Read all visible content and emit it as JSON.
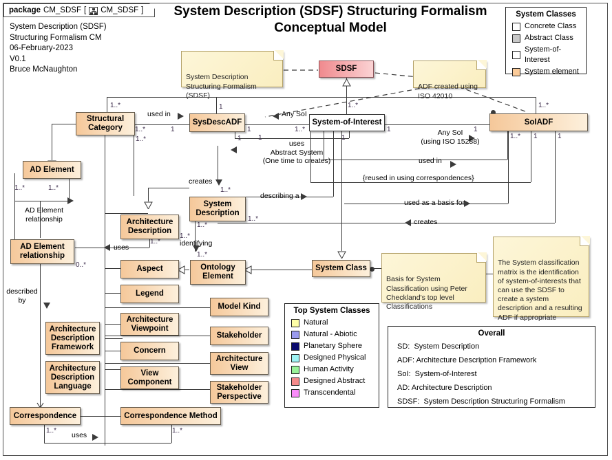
{
  "package": {
    "keyword": "package",
    "name": "CM_SDSF",
    "bracket_open": "[",
    "icon": "diagram-icon",
    "diagram_name": "CM_SDSF",
    "bracket_close": "]"
  },
  "meta": "System Description (SDSF)\nStructuring Formalism CM\n06-February-2023\nV0.1\nBruce McNaughton",
  "title": "System Description (SDSF)\nStructuring Formalism Conceptual Model",
  "classes": {
    "structural_category": "Structural\nCategory",
    "sysdescadf": "SysDescADF",
    "system_of_interest": "System-of-Interest",
    "soiadf": "SoIADF",
    "sdsf": "SDSF",
    "ad_element": "AD Element",
    "ad_element_relationship": "AD Element\nrelationship",
    "system_description": "System\nDescription",
    "architecture_description": "Architecture\nDescription",
    "aspect": "Aspect",
    "ontology_element": "Ontology\nElement",
    "legend": "Legend",
    "system_class": "System Class",
    "model_kind": "Model Kind",
    "stakeholder": "Stakeholder",
    "architecture_view": "Architecture\nView",
    "stakeholder_perspective": "Stakeholder\nPerspective",
    "architecture_viewpoint": "Architecture\nViewpoint",
    "concern": "Concern",
    "view_component": "View\nComponent",
    "adf": "Architecture\nDescription\nFramework",
    "adl": "Architecture\nDescription\nLanguage",
    "correspondence": "Correspondence",
    "correspondence_method": "Correspondence Method"
  },
  "notes": {
    "sdsf_note": "System Description\nStructuring Formalism\n(SDSF)",
    "adf_iso_note": "ADF created using\nISO 42010",
    "basis_note": "Basis for System\nClassification using Peter\nCheckland's top level\nClassifications",
    "matrix_note": "The System classification\nmatrix is the identification\nof system-of-interests that\ncan use the SDSF to\ncreate a system\ndescription and a resulting\nADF if appropriate"
  },
  "edge_labels": {
    "used_in_1": "used in",
    "any_soi_1": "Any SoI",
    "any_soi_iso": "Any SoI\n(using ISO 15288)",
    "uses_abstract": "uses\nAbstract System\n(One time to creates)",
    "used_in_2": "used in",
    "reused_note": "{reused in using correspondences}",
    "creates_top": "creates",
    "describing_a": "describing a",
    "used_as_basis_for": "used as a basis for",
    "creates_right": "creates",
    "uses_ad": "uses",
    "identifying": "identifying",
    "ad_element_relationship_label": "AD Element\nrelationship",
    "described_by": "described\nby",
    "uses_corr": "uses"
  },
  "multiplicities": {
    "m1": "1..*",
    "m2": "1..*",
    "m3": "1..*",
    "m4": "1",
    "m5": "1",
    "m6": "1",
    "m7": "1..*",
    "m8": "1",
    "m9": "1..*",
    "m10": "1",
    "m11": "1",
    "m12": "1..*",
    "m13": "1",
    "m14": "1",
    "m15": "1..*",
    "m16": "1..*",
    "m17": "1..*",
    "m18": "1..*",
    "m19": "1..*",
    "m20": "1",
    "m21": "1..*",
    "m22": "0..*",
    "m23": "1..*",
    "m24": "1..*",
    "m25": "1..*",
    "m26": "1"
  },
  "system_classes_legend": {
    "title": "System Classes",
    "items": [
      {
        "label": "Concrete Class",
        "color": "#ffffff"
      },
      {
        "label": "Abstract Class",
        "color": "#c8c8c8"
      },
      {
        "label": "System-of-Interest",
        "color": "#ffffff"
      },
      {
        "label": "System element",
        "color": "#fbcb99"
      }
    ]
  },
  "top_system_classes_legend": {
    "title": "Top System Classes",
    "items": [
      {
        "label": "Natural",
        "color": "#ffffa8"
      },
      {
        "label": "Natural - Abiotic",
        "color": "#9a9aee"
      },
      {
        "label": "Planetary Sphere",
        "color": "#0a0a6e"
      },
      {
        "label": "Designed Physical",
        "color": "#9ef3f3"
      },
      {
        "label": "Human Activity",
        "color": "#99f299"
      },
      {
        "label": "Designed Abstract",
        "color": "#f58b8b"
      },
      {
        "label": "Transcendental",
        "color": "#f98df9"
      }
    ]
  },
  "overall_legend": {
    "title": "Overall",
    "lines": [
      "SD:  System Description",
      "ADF: Architecture Description Framework",
      "SoI:  System-of-Interest",
      "AD: Architecture Description",
      "SDSF:  System Description Structuring Formalism"
    ]
  }
}
